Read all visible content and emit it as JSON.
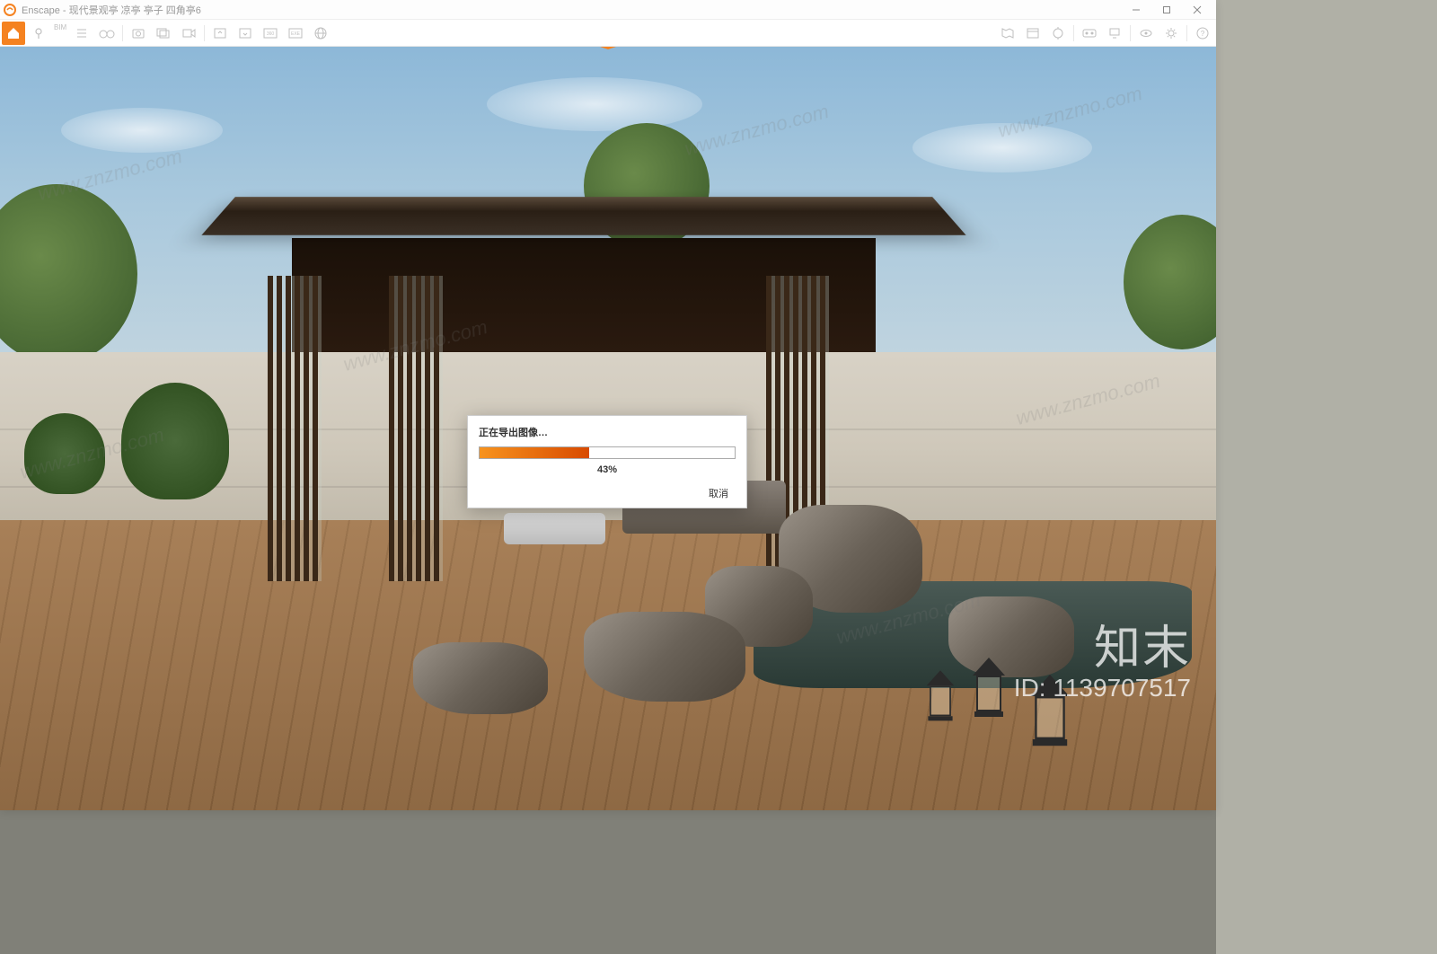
{
  "window": {
    "app_name": "Enscape",
    "title_suffix": " - 现代景观亭 凉亭 亭子 四角亭6"
  },
  "toolbar": {
    "bim_label": "BIM"
  },
  "dialog": {
    "title": "正在导出图像…",
    "percent_text": "43%",
    "percent_value": 43,
    "cancel": "取消"
  },
  "overlay": {
    "brand": "知末",
    "id_label": "ID: 1139707517",
    "watermark": "www.znzmo.com"
  },
  "colors": {
    "accent": "#f58220",
    "progress_start": "#f7931e",
    "progress_end": "#d84a00"
  }
}
